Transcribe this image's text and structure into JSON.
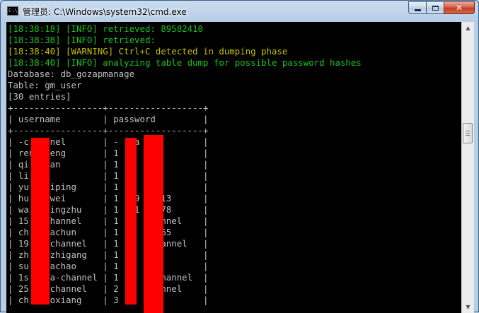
{
  "window": {
    "title": "管理员: C:\\Windows\\system32\\cmd.exe",
    "icon_text": "C:\\",
    "buttons": {
      "minimize": "minimize",
      "maximize": "maximize",
      "close": "✕"
    }
  },
  "console": {
    "log_lines": [
      {
        "text": "[18:38:18] [INFO] retrieved: 89582410",
        "color": "green"
      },
      {
        "text": "[18:38:38] [INFO] retrieved:",
        "color": "green"
      },
      {
        "text": "[18:38:40] [WARNING] Ctrl+C detected in dumping phase",
        "color": "yellow"
      },
      {
        "text": "[18:38:40] [INFO] analyzing table dump for possible password hashes",
        "color": "green"
      }
    ],
    "database_line": "Database: db_gozapmanage",
    "table_line": "Table: gm_user",
    "entries_line": "[30 entries]",
    "table": {
      "border_line": "+-----------------+------------------+",
      "header_line": "| username        | password         |",
      "rows": [
        "| -c    nel       | -   a   l        |",
        "| ren  feng       | 1  2             |",
        "| qi    an        | 1  $             |",
        "| li              | 1  4             |",
        "| yu    iping     | 1  4   *         |",
        "| hu    wei       | 1   9  9913      |",
        "| wa    ingzhu    | 1   1  8978      |",
        "| 15    hannel    | 1  -    annel    |",
        "| ch    achun     | 1  0   5765      |",
        "| 19    channel   | 1  m    hannel   |",
        "| zh    zhigang   | 1  9   0         |",
        "| su    achao     | 1  9             |",
        "| 1s    a-channel | 1  h   -channel  |",
        "| 25    channel   | 2  p    annel    |",
        "| ch    oxiang    | 3  2             |"
      ]
    }
  },
  "colors": {
    "console_bg": "#000000",
    "console_text": "#c0c0c0",
    "info_green": "#17c417",
    "warning_yellow": "#c0c000",
    "redaction_red": "#ff0000"
  },
  "scrollbar": {
    "up_arrow": "▲",
    "down_arrow": "▼",
    "position": 0.35
  }
}
